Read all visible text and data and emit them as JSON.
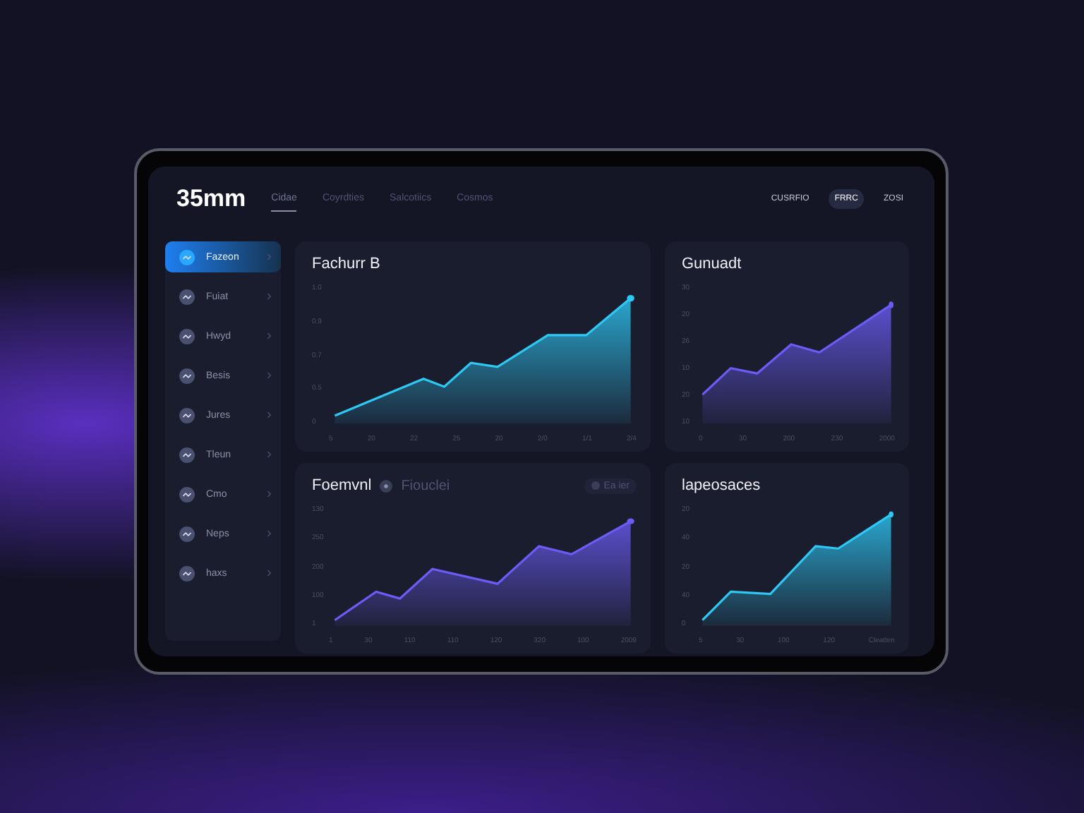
{
  "header": {
    "logo": "35mm",
    "tabs": [
      {
        "label": "Cidae",
        "selected": true
      },
      {
        "label": "Coyrdties",
        "selected": false
      },
      {
        "label": "Salcotiics",
        "selected": false
      },
      {
        "label": "Cosmos",
        "selected": false
      }
    ],
    "actions": [
      {
        "label": "CUSRFIO",
        "selected": false
      },
      {
        "label": "FRRC",
        "selected": true
      },
      {
        "label": "ZOSI",
        "selected": false
      }
    ]
  },
  "sidebar": {
    "items": [
      {
        "label": "Fazeon",
        "selected": true
      },
      {
        "label": "Fuiat",
        "selected": false
      },
      {
        "label": "Hwyd",
        "selected": false
      },
      {
        "label": "Besis",
        "selected": false
      },
      {
        "label": "Jures",
        "selected": false
      },
      {
        "label": "Tleun",
        "selected": false
      },
      {
        "label": "Cmo",
        "selected": false
      },
      {
        "label": "Neps",
        "selected": false
      },
      {
        "label": "haxs",
        "selected": false
      }
    ]
  },
  "charts": [
    {
      "title": "Fachurr B",
      "color": "#2ec8f5",
      "yticks": [
        "1.0",
        "0.9",
        "0.7",
        "0.5",
        "0"
      ],
      "xticks": [
        "5",
        "20",
        "22",
        "25",
        "20",
        "2/0",
        "1/1",
        "2/4"
      ]
    },
    {
      "title": "Gunuadt",
      "color": "#6a5cf5",
      "yticks": [
        "30",
        "20",
        "26",
        "10",
        "20",
        "10"
      ],
      "xticks": [
        "0",
        "30",
        "200",
        "230",
        "2000"
      ]
    },
    {
      "title": "Foemvnl",
      "subtitle": "Fiouclei",
      "badge": "Ea ier",
      "color": "#6a5cf5",
      "yticks": [
        "130",
        "250",
        "200",
        "100",
        "1"
      ],
      "xticks": [
        "1",
        "30",
        "110",
        "110",
        "120",
        "320",
        "100",
        "2009"
      ]
    },
    {
      "title": "lapeosaces",
      "color": "#2ec8f5",
      "yticks": [
        "20",
        "40",
        "20",
        "40",
        "0"
      ],
      "xticks": [
        "5",
        "30",
        "100",
        "120",
        "Cleatten"
      ]
    }
  ]
}
